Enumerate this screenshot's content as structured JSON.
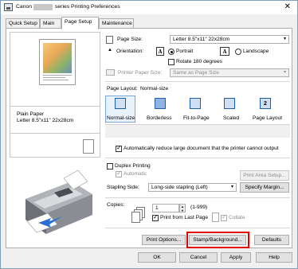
{
  "window": {
    "title_prefix": "Canon",
    "title_suffix": "series Printing Preferences",
    "close_glyph": "✕"
  },
  "tabs": [
    {
      "label": "Quick Setup"
    },
    {
      "label": "Main"
    },
    {
      "label": "Page Setup"
    },
    {
      "label": "Maintenance"
    }
  ],
  "preview": {
    "paper_line1": "Plain Paper",
    "paper_line2": "Letter 8.5\"x11\" 22x28cm"
  },
  "page_size": {
    "label": "Page Size:",
    "value": "Letter 8.5\"x11\" 22x28cm"
  },
  "orientation": {
    "label": "Orientation:",
    "portrait": "Portrait",
    "landscape": "Landscape",
    "rotate": "Rotate 180 degrees",
    "glyph": "A"
  },
  "printer_paper_size": {
    "label": "Printer Paper Size:",
    "value": "Same as Page Size"
  },
  "page_layout": {
    "label": "Page Layout:",
    "current": "Normal-size",
    "options": [
      "Normal-size",
      "Borderless",
      "Fit-to-Page",
      "Scaled",
      "Page Layout"
    ],
    "page_layout_badge": "2"
  },
  "auto_reduce": {
    "label": "Automatically reduce large document that the printer cannot output"
  },
  "duplex": {
    "label": "Duplex Printing",
    "automatic": "Automatic",
    "print_area_button": "Print Area Setup..."
  },
  "stapling": {
    "label": "Stapling Side:",
    "value": "Long-side stapling (Left)",
    "margin_button": "Specify Margin..."
  },
  "copies": {
    "label": "Copies:",
    "value": "1",
    "range": "(1-999)",
    "print_last": "Print from Last Page",
    "collate": "Collate"
  },
  "bottom_buttons": {
    "print_options": "Print Options...",
    "stamp": "Stamp/Background...",
    "defaults": "Defaults"
  },
  "dialog_buttons": {
    "ok": "OK",
    "cancel": "Cancel",
    "apply": "Apply",
    "help": "Help"
  }
}
